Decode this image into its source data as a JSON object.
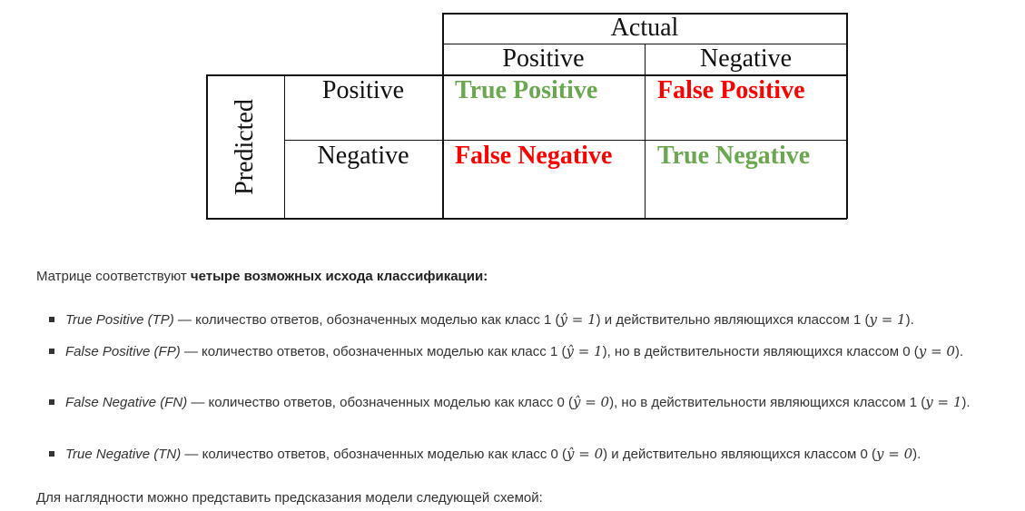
{
  "matrix": {
    "actual_label": "Actual",
    "predicted_label": "Predicted",
    "col_headers": [
      "Positive",
      "Negative"
    ],
    "row_headers": [
      "Positive",
      "Negative"
    ],
    "cells": {
      "tp": "True Positive",
      "fp": "False Positive",
      "fn": "False Negative",
      "tn": "True Negative"
    },
    "colors": {
      "true": "#6aa84f",
      "false": "#ff0000"
    }
  },
  "text": {
    "intro_plain": "Матрице соответствуют ",
    "intro_bold": "четыре возможных исхода классификации:",
    "items": [
      {
        "term": "True Positive (TP)",
        "part1": " — количество ответов, обозначенных моделью как класс 1 (",
        "math1": "ŷ = 1",
        "part2": ") и действительно являющихся классом 1 (",
        "math2": "y = 1",
        "part3": ")."
      },
      {
        "term": "False Positive (FP)",
        "part1": " — количество ответов, обозначенных моделью как класс 1 (",
        "math1": "ŷ = 1",
        "part2": "), но в действительности являющихся классом 0 (",
        "math2": "y = 0",
        "part3": ")."
      },
      {
        "term": "False Negative (FN)",
        "part1": " — количество ответов, обозначенных моделью как класс 0 (",
        "math1": "ŷ = 0",
        "part2": "), но в действительности являющихся классом 1 (",
        "math2": "y = 1",
        "part3": ")."
      },
      {
        "term": "True Negative (TN)",
        "part1": " — количество ответов, обозначенных моделью как класс 0 (",
        "math1": "ŷ = 0",
        "part2": ") и действительно являющихся классом 0 (",
        "math2": "y = 0",
        "part3": ")."
      }
    ],
    "outro": "Для наглядности можно представить предсказания модели следующей схемой:"
  }
}
